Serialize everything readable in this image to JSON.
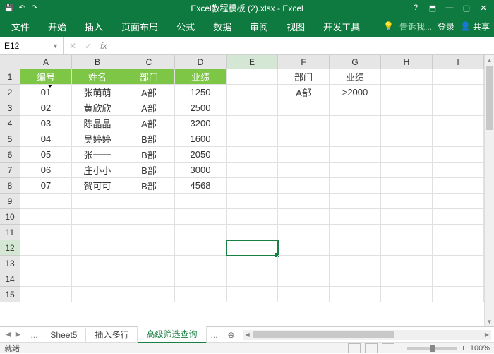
{
  "titlebar": {
    "title": "Excel教程模板 (2).xlsx - Excel",
    "qat_save": "💾",
    "qat_undo": "↶",
    "qat_redo": "↷"
  },
  "window": {
    "help": "?",
    "ribmin": "⬒",
    "min": "—",
    "max": "▢",
    "close": "✕"
  },
  "tabs": {
    "file": "文件",
    "home": "开始",
    "insert": "插入",
    "layout": "页面布局",
    "formula": "公式",
    "data": "数据",
    "review": "审阅",
    "view": "视图",
    "dev": "开发工具",
    "tell_icon": "💡",
    "tell": "告诉我...",
    "login": "登录",
    "share": "共享"
  },
  "namebox": {
    "ref": "E12",
    "fx": "fx",
    "cancel": "✕",
    "ok": "✓"
  },
  "cols": [
    "A",
    "B",
    "C",
    "D",
    "E",
    "F",
    "G",
    "H",
    "I"
  ],
  "rows": [
    "1",
    "2",
    "3",
    "4",
    "5",
    "6",
    "7",
    "8",
    "9",
    "10",
    "11",
    "12",
    "13",
    "14",
    "15"
  ],
  "headers": {
    "c0": "编号",
    "c1": "姓名",
    "c2": "部门",
    "c3": "业绩"
  },
  "criteria": {
    "h0": "部门",
    "h1": "业绩",
    "v0": "A部",
    "v1": ">2000"
  },
  "data": [
    {
      "id": "01",
      "name": "张萌萌",
      "dept": "A部",
      "val": "1250"
    },
    {
      "id": "02",
      "name": "黄欣欣",
      "dept": "A部",
      "val": "2500"
    },
    {
      "id": "03",
      "name": "陈晶晶",
      "dept": "A部",
      "val": "3200"
    },
    {
      "id": "04",
      "name": "吴婷婷",
      "dept": "B部",
      "val": "1600"
    },
    {
      "id": "05",
      "name": "张一一",
      "dept": "B部",
      "val": "2050"
    },
    {
      "id": "06",
      "name": "庄小小",
      "dept": "B部",
      "val": "3000"
    },
    {
      "id": "07",
      "name": "贺可可",
      "dept": "B部",
      "val": "4568"
    }
  ],
  "sheets": {
    "dots": "...",
    "s1": "Sheet5",
    "s2": "插入多行",
    "s3": "高级筛选查询",
    "add": "⊕"
  },
  "status": {
    "ready": "就绪",
    "zoom": "100%",
    "minus": "−",
    "plus": "+"
  },
  "cursor_glyph": "✥"
}
